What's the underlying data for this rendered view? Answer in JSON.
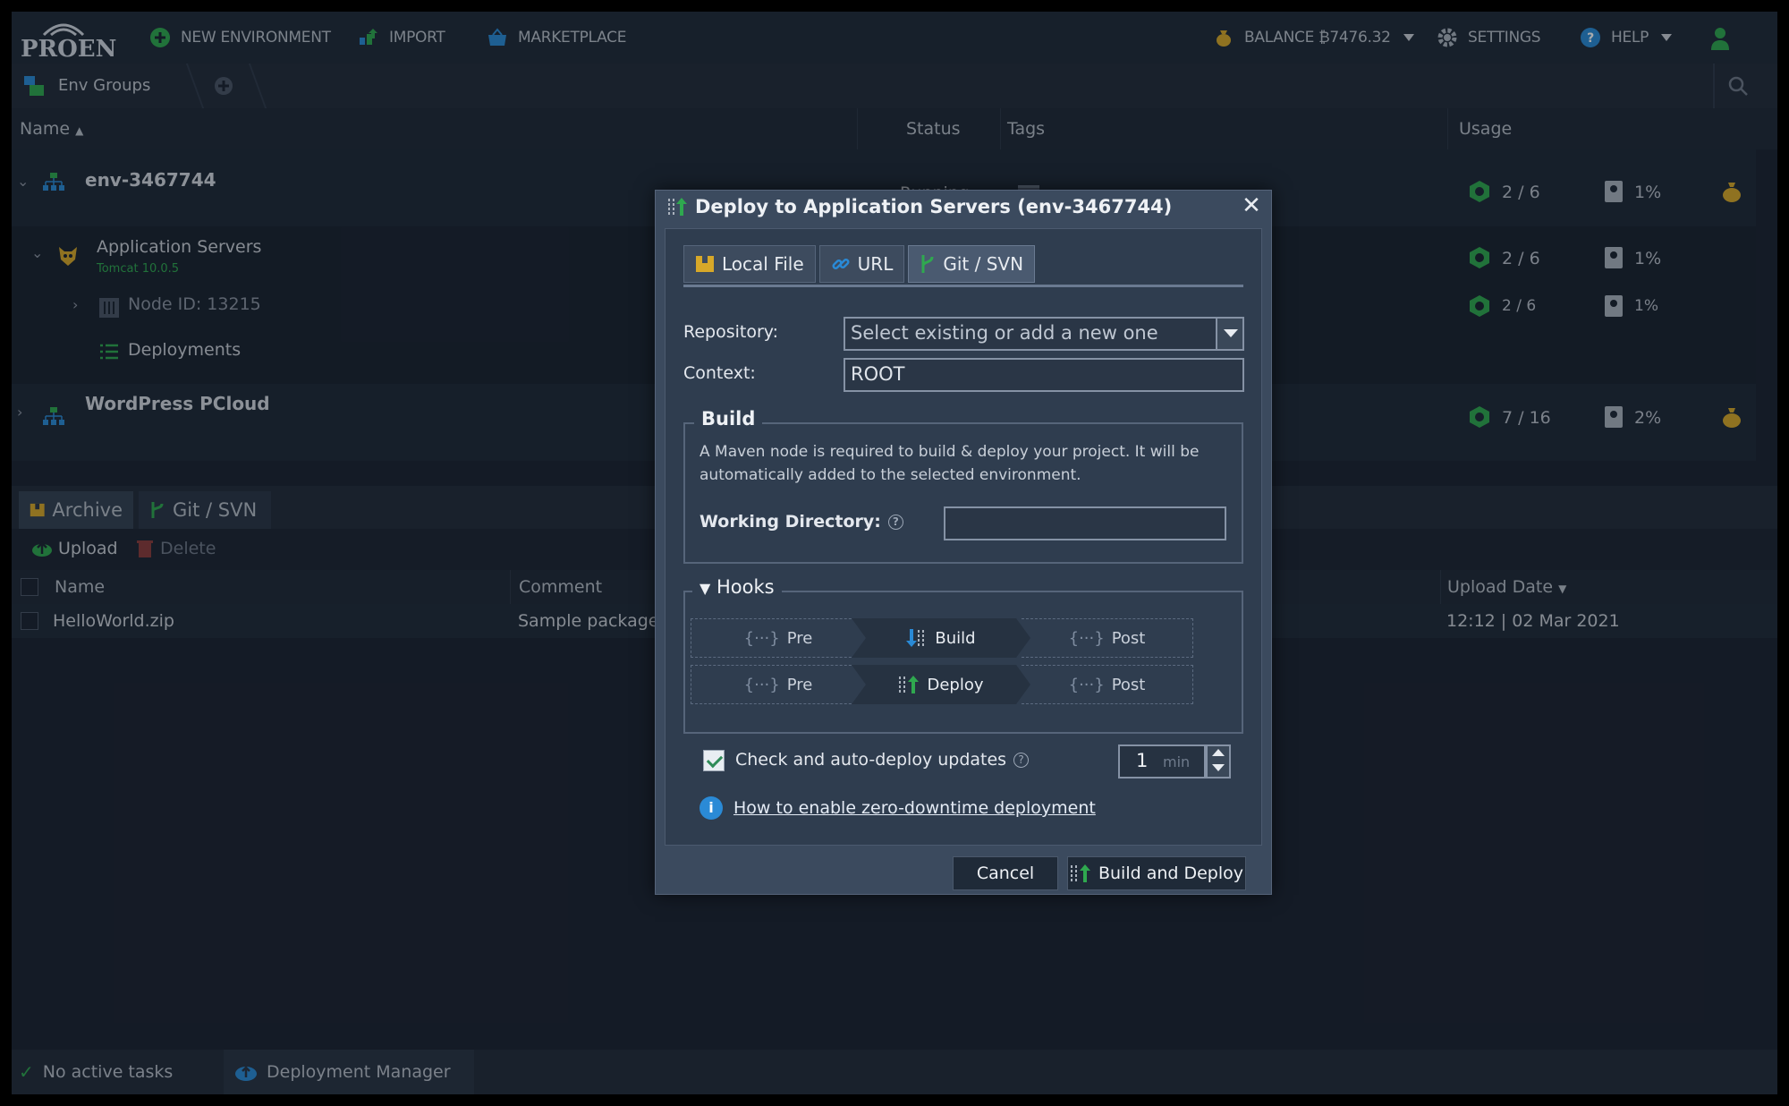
{
  "nav": {
    "logo": "PROEN",
    "new_env": "NEW ENVIRONMENT",
    "import": "IMPORT",
    "marketplace": "MARKETPLACE",
    "balance": "BALANCE ₿7476.32",
    "settings": "SETTINGS",
    "help": "HELP"
  },
  "groups": {
    "label": "Env Groups"
  },
  "columns": {
    "name": "Name",
    "status": "Status",
    "tags": "Tags",
    "usage": "Usage"
  },
  "envs": [
    {
      "name": "env-3467744",
      "status": "Running",
      "cloudlets": "2 / 6",
      "disk": "1%"
    },
    {
      "name": "WordPress PCloud",
      "cloudlets": "7 / 16",
      "disk": "2%"
    }
  ],
  "app_servers": {
    "label": "Application Servers",
    "sub": "Tomcat 10.0.5",
    "cloudlets": "2 / 6",
    "disk": "1%"
  },
  "node": {
    "label": "Node ID: 13215",
    "cloudlets": "2 / 6",
    "disk": "1%"
  },
  "deployments": {
    "label": "Deployments"
  },
  "lower": {
    "tabs": [
      "Archive",
      "Git / SVN"
    ],
    "upload": "Upload",
    "delete": "Delete",
    "headers": {
      "name": "Name",
      "comment": "Comment",
      "date": "Upload Date"
    },
    "rows": [
      {
        "name": "HelloWorld.zip",
        "comment": "Sample package w",
        "date": "12:12 | 02 Mar 2021"
      }
    ]
  },
  "status": {
    "tasks": "No active tasks",
    "manager": "Deployment Manager"
  },
  "dialog": {
    "title": "Deploy to Application Servers (env-3467744)",
    "tabs": [
      "Local File",
      "URL",
      "Git / SVN"
    ],
    "repository_label": "Repository:",
    "repository_placeholder": "Select existing or add a new one",
    "context_label": "Context:",
    "context_value": "ROOT",
    "build_legend": "Build",
    "build_help": "A Maven node is required to build & deploy your project. It will be automatically added to the selected environment.",
    "workdir_label": "Working Directory:",
    "hooks_legend": "Hooks",
    "hooks": {
      "build_row": {
        "pre": "Pre",
        "main": "Build",
        "post": "Post"
      },
      "deploy_row": {
        "pre": "Pre",
        "main": "Deploy",
        "post": "Post"
      }
    },
    "autodeploy_label": "Check and auto-deploy updates",
    "interval_value": "1",
    "interval_unit": "min",
    "link": "How to enable zero-downtime deployment",
    "cancel": "Cancel",
    "submit": "Build and Deploy"
  },
  "colors": {
    "accent_green": "#2fa84f",
    "accent_blue": "#2a8ad6",
    "panel": "#1b2230"
  }
}
